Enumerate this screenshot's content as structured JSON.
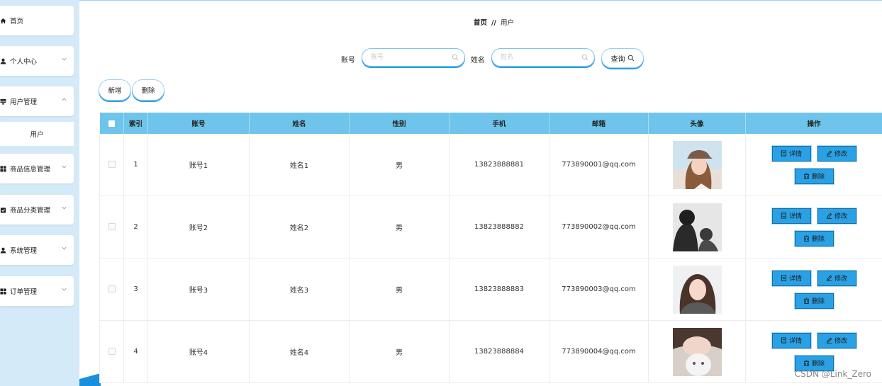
{
  "sidebar": {
    "items": [
      {
        "label": "首页",
        "icon": "home-icon",
        "chevron": false
      },
      {
        "label": "个人中心",
        "icon": "user-icon",
        "chevron": true
      },
      {
        "label": "用户管理",
        "icon": "list-icon",
        "chevron": true
      },
      {
        "label": "商品信息管理",
        "icon": "grid-icon",
        "chevron": true
      },
      {
        "label": "商品分类管理",
        "icon": "clipboard-icon",
        "chevron": true
      },
      {
        "label": "系统管理",
        "icon": "user-icon",
        "chevron": true
      },
      {
        "label": "订单管理",
        "icon": "grid-icon",
        "chevron": true
      }
    ],
    "submenu": {
      "label": "用户"
    }
  },
  "breadcrumb": {
    "home": "首页",
    "separator": "//",
    "current": "用户"
  },
  "search": {
    "account_label": "账号",
    "account_placeholder": "账号",
    "name_label": "姓名",
    "name_placeholder": "姓名",
    "query_label": "查询"
  },
  "actions": {
    "add_label": "新增",
    "delete_label": "删除"
  },
  "table": {
    "headers": [
      "索引",
      "账号",
      "姓名",
      "性别",
      "手机",
      "邮箱",
      "头像",
      "操作"
    ],
    "rows": [
      {
        "index": "1",
        "account": "账号1",
        "name": "姓名1",
        "gender": "男",
        "phone": "13823888881",
        "email": "773890001@qq.com"
      },
      {
        "index": "2",
        "account": "账号2",
        "name": "姓名2",
        "gender": "男",
        "phone": "13823888882",
        "email": "773890002@qq.com"
      },
      {
        "index": "3",
        "account": "账号3",
        "name": "姓名3",
        "gender": "男",
        "phone": "13823888883",
        "email": "773890003@qq.com"
      },
      {
        "index": "4",
        "account": "账号4",
        "name": "姓名4",
        "gender": "男",
        "phone": "13823888884",
        "email": "773890004@qq.com"
      }
    ],
    "row_actions": {
      "detail": "详情",
      "edit": "修改",
      "delete": "删除"
    }
  },
  "watermark": "CSDN @Link_Zero",
  "colors": {
    "accent": "#2aa1e4",
    "header_bg": "#6ec4ea",
    "sidebar_bg": "#d4eaf8"
  }
}
